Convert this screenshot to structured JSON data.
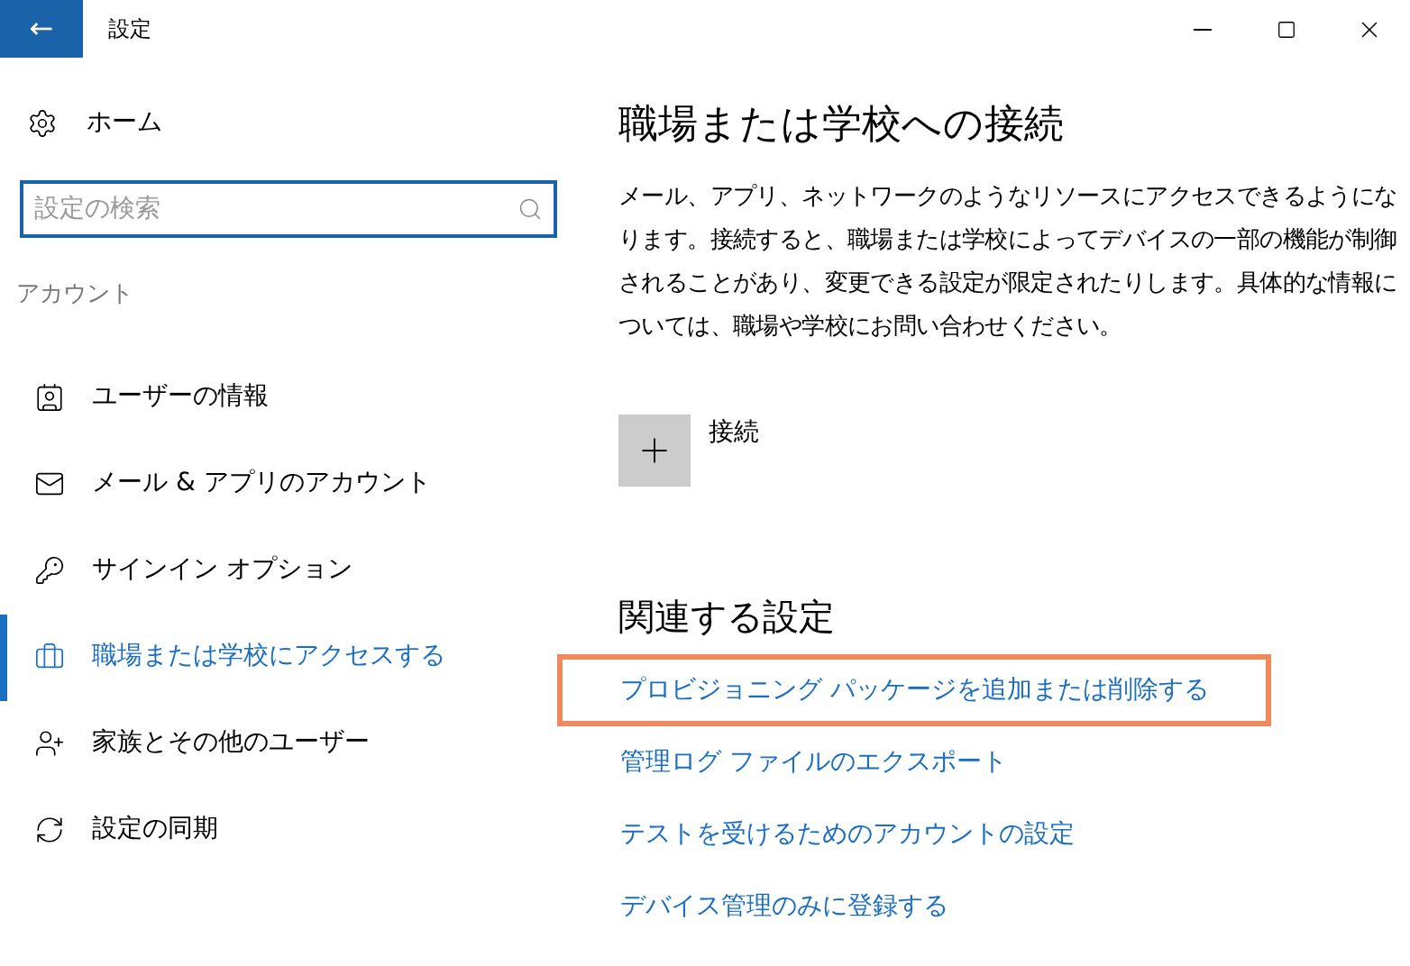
{
  "window": {
    "title": "設定",
    "back": "←"
  },
  "sidebar": {
    "home": "ホーム",
    "search": {
      "placeholder": "設定の検索"
    },
    "section": "アカウント",
    "items": [
      {
        "label": "ユーザーの情報",
        "selected": false
      },
      {
        "label": "メール & アプリのアカウント",
        "selected": false
      },
      {
        "label": "サインイン オプション",
        "selected": false
      },
      {
        "label": "職場または学校にアクセスする",
        "selected": true
      },
      {
        "label": "家族とその他のユーザー",
        "selected": false
      },
      {
        "label": "設定の同期",
        "selected": false
      }
    ]
  },
  "main": {
    "title": "職場または学校への接続",
    "description": "メール、アプリ、ネットワークのようなリソースにアクセスできるようになります。接続すると、職場または学校によってデバイスの一部の機能が制御されることがあり、変更できる設定が限定されたりします。具体的な情報については、職場や学校にお問い合わせください。",
    "connect": "接続",
    "related_title": "関連する設定",
    "links": [
      {
        "label": "プロビジョニング パッケージを追加または削除する",
        "highlighted": true
      },
      {
        "label": "管理ログ ファイルのエクスポート",
        "highlighted": false
      },
      {
        "label": "テストを受けるためのアカウントの設定",
        "highlighted": false
      },
      {
        "label": "デバイス管理のみに登録する",
        "highlighted": false
      }
    ]
  }
}
